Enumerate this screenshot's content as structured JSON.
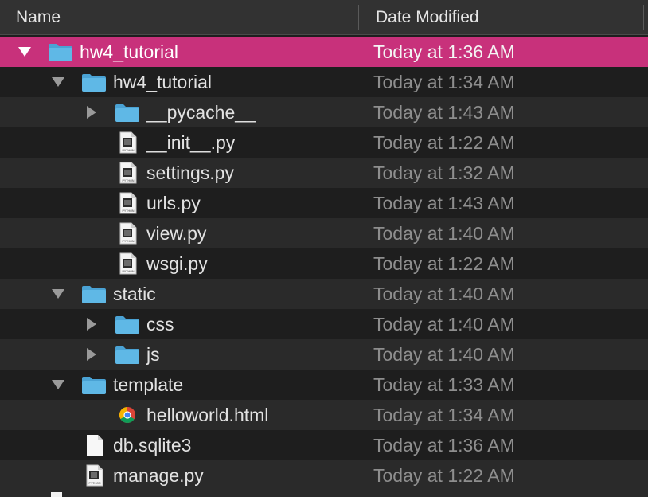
{
  "header": {
    "name_label": "Name",
    "date_label": "Date Modified"
  },
  "rows": [
    {
      "name": "hw4_tutorial",
      "date": "Today at 1:36 AM",
      "icon": "folder-icon",
      "disclosure": "expanded"
    },
    {
      "name": "hw4_tutorial",
      "date": "Today at 1:34 AM",
      "icon": "folder-icon",
      "disclosure": "expanded"
    },
    {
      "name": "__pycache__",
      "date": "Today at 1:43 AM",
      "icon": "folder-icon",
      "disclosure": "collapsed"
    },
    {
      "name": "__init__.py",
      "date": "Today at 1:22 AM",
      "icon": "python-file-icon"
    },
    {
      "name": "settings.py",
      "date": "Today at 1:32 AM",
      "icon": "python-file-icon"
    },
    {
      "name": "urls.py",
      "date": "Today at 1:43 AM",
      "icon": "python-file-icon"
    },
    {
      "name": "view.py",
      "date": "Today at 1:40 AM",
      "icon": "python-file-icon"
    },
    {
      "name": "wsgi.py",
      "date": "Today at 1:22 AM",
      "icon": "python-file-icon"
    },
    {
      "name": "static",
      "date": "Today at 1:40 AM",
      "icon": "folder-icon",
      "disclosure": "expanded"
    },
    {
      "name": "css",
      "date": "Today at 1:40 AM",
      "icon": "folder-icon",
      "disclosure": "collapsed"
    },
    {
      "name": "js",
      "date": "Today at 1:40 AM",
      "icon": "folder-icon",
      "disclosure": "collapsed"
    },
    {
      "name": "template",
      "date": "Today at 1:33 AM",
      "icon": "folder-icon",
      "disclosure": "expanded"
    },
    {
      "name": "helloworld.html",
      "date": "Today at 1:34 AM",
      "icon": "chrome-html-file-icon"
    },
    {
      "name": "db.sqlite3",
      "date": "Today at 1:36 AM",
      "icon": "blank-document-icon"
    },
    {
      "name": "manage.py",
      "date": "Today at 1:22 AM",
      "icon": "python-file-icon"
    }
  ],
  "python_badge": "PYTHON",
  "colors": {
    "selection": "#c8317b",
    "folder": "#5fb8e6",
    "row_alt": "#2a2a2a",
    "row_base": "#1e1e1e",
    "date_text": "#8e8e8e"
  }
}
